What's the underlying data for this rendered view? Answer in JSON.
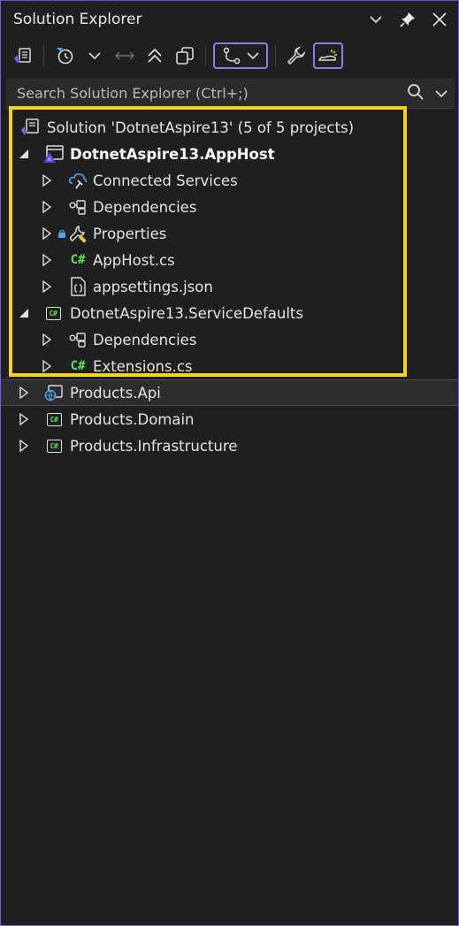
{
  "window": {
    "title": "Solution Explorer"
  },
  "search": {
    "placeholder": "Search Solution Explorer (Ctrl+;)"
  },
  "tree": {
    "solution": "Solution 'DotnetAspire13' (5 of 5 projects)",
    "apphost": {
      "label": "DotnetAspire13.AppHost",
      "children": [
        "Connected Services",
        "Dependencies",
        "Properties",
        "AppHost.cs",
        "appsettings.json"
      ]
    },
    "servicedefaults": {
      "label": "DotnetAspire13.ServiceDefaults",
      "children": [
        "Dependencies",
        "Extensions.cs"
      ]
    },
    "projects": [
      "Products.Api",
      "Products.Domain",
      "Products.Infrastructure"
    ]
  },
  "icons": {
    "csharp_text": "C#"
  },
  "colors": {
    "accent": "#8a7dea",
    "highlight": "#f5d323",
    "csharp": "#5ee05e",
    "background": "#1f1f1f"
  }
}
